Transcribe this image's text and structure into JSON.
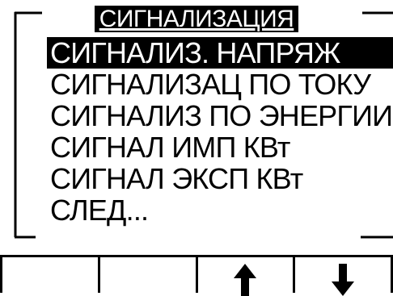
{
  "menu": {
    "title": "СИГНАЛИЗАЦИЯ",
    "items": [
      {
        "label": "СИГНАЛИЗ. НАПРЯЖ",
        "selected": true
      },
      {
        "label": "СИГНАЛИЗАЦ ПО ТОКУ",
        "selected": false
      },
      {
        "label": "СИГНАЛИЗ ПО ЭНЕРГИИ",
        "selected": false
      },
      {
        "label": "СИГНАЛ ИМП КВт",
        "selected": false
      },
      {
        "label": "СИГНАЛ ЭКСП КВт",
        "selected": false
      },
      {
        "label": "СЛЕД...",
        "selected": false
      }
    ]
  },
  "softkeys": [
    {
      "icon": "blank"
    },
    {
      "icon": "blank"
    },
    {
      "icon": "arrow-up-icon"
    },
    {
      "icon": "arrow-down-icon"
    }
  ]
}
